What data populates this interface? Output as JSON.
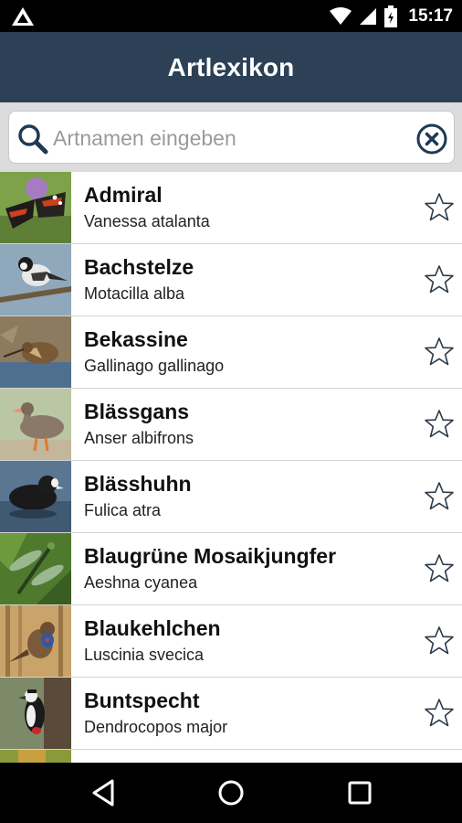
{
  "status_bar": {
    "time": "15:17",
    "icons": [
      "notification-icon",
      "wifi-icon",
      "signal-icon",
      "battery-icon"
    ]
  },
  "app_bar": {
    "title": "Artlexikon",
    "color": "#2c4156"
  },
  "search": {
    "placeholder": "Artnamen eingeben",
    "value": ""
  },
  "species": [
    {
      "name": "Admiral",
      "latin": "Vanessa atalanta",
      "thumb": "butterfly"
    },
    {
      "name": "Bachstelze",
      "latin": "Motacilla alba",
      "thumb": "wagtail"
    },
    {
      "name": "Bekassine",
      "latin": "Gallinago gallinago",
      "thumb": "snipe"
    },
    {
      "name": "Blässgans",
      "latin": "Anser albifrons",
      "thumb": "goose"
    },
    {
      "name": "Blässhuhn",
      "latin": "Fulica atra",
      "thumb": "coot"
    },
    {
      "name": "Blaugrüne Mosaikjungfer",
      "latin": "Aeshna cyanea",
      "thumb": "dragonfly"
    },
    {
      "name": "Blaukehlchen",
      "latin": "Luscinia svecica",
      "thumb": "bluethroat"
    },
    {
      "name": "Buntspecht",
      "latin": "Dendrocopos major",
      "thumb": "woodpecker"
    },
    {
      "name": "",
      "latin": "",
      "thumb": "partial"
    }
  ],
  "nav_bar": {
    "buttons": [
      "back-icon",
      "home-icon",
      "recents-icon"
    ]
  }
}
